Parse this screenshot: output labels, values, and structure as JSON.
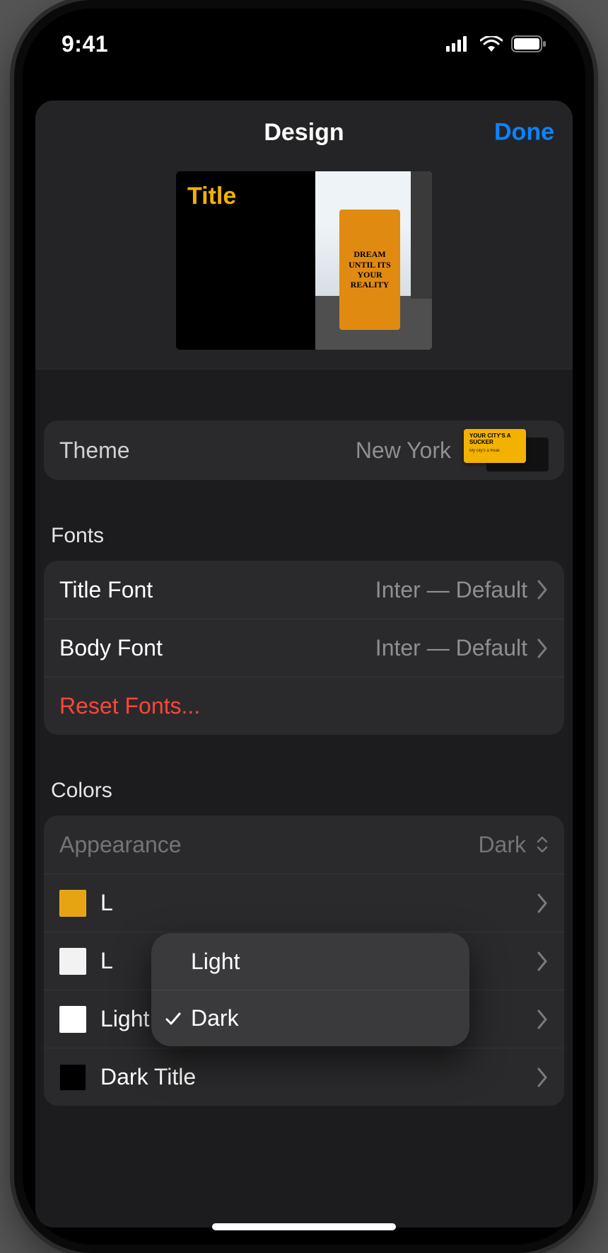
{
  "status": {
    "time": "9:41"
  },
  "header": {
    "title": "Design",
    "done": "Done"
  },
  "preview": {
    "title": "Title",
    "graffiti": "DREAM UNTIL ITS YOUR REALITY"
  },
  "theme": {
    "label": "Theme",
    "value": "New York",
    "thumb_title": "YOUR CITY'S A SUCKER",
    "thumb_sub": "My city's a freak"
  },
  "fonts": {
    "section": "Fonts",
    "title_font_label": "Title Font",
    "title_font_value": "Inter  — Default",
    "body_font_label": "Body Font",
    "body_font_value": "Inter  — Default",
    "reset": "Reset Fonts..."
  },
  "colors": {
    "section": "Colors",
    "appearance_label": "Appearance",
    "appearance_value": "Dark",
    "rows": [
      {
        "label": "L",
        "swatch": "#e6a413"
      },
      {
        "label": "L",
        "swatch": "#f2f2f2"
      },
      {
        "label": "Light Background",
        "swatch": "#ffffff"
      },
      {
        "label": "Dark Title",
        "swatch": "#000000"
      }
    ]
  },
  "popover": {
    "options": [
      {
        "label": "Light",
        "checked": false
      },
      {
        "label": "Dark",
        "checked": true
      }
    ]
  }
}
